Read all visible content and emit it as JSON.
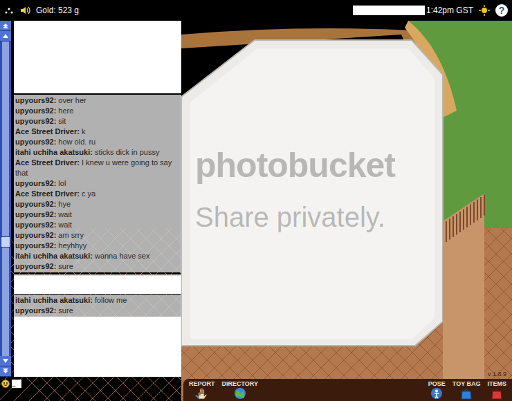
{
  "top_bar": {
    "gold": "Gold: 523 g",
    "time": "1:42pm GST",
    "help": "?"
  },
  "chat": {
    "messages_top": [
      {
        "user": "upyours92:",
        "text": "over her"
      },
      {
        "user": "upyours92:",
        "text": "here"
      },
      {
        "user": "upyours92:",
        "text": "sit"
      },
      {
        "user": "Ace Street Driver:",
        "text": "k"
      },
      {
        "user": "upyours92:",
        "text": "how old. ru"
      },
      {
        "user": "itahi uchiha akatsuki:",
        "text": "sticks dick in pussy"
      },
      {
        "user": "Ace Street Driver:",
        "text": "I knew u were going to say that"
      },
      {
        "user": "upyours92:",
        "text": "lol"
      },
      {
        "user": "Ace Street Driver:",
        "text": "c ya"
      },
      {
        "user": "upyours92:",
        "text": "hye"
      },
      {
        "user": "upyours92:",
        "text": "wait"
      },
      {
        "user": "upyours92:",
        "text": "wait"
      },
      {
        "user": "upyours92:",
        "text": "am srry"
      },
      {
        "user": "upyours92:",
        "text": "heyhhyy"
      },
      {
        "user": "itahi uchiha akatsuki:",
        "text": "wanna have sex"
      },
      {
        "user": "upyours92:",
        "text": "sure"
      }
    ],
    "messages_bottom": [
      {
        "user": "itahi uchiha akatsuki:",
        "text": "follow me"
      },
      {
        "user": "upyours92:",
        "text": "sure"
      }
    ],
    "input": "_"
  },
  "toolbar": [
    {
      "label": "REPORT"
    },
    {
      "label": "DIRECTORY"
    },
    {
      "label": "POSE"
    },
    {
      "label": "TOY BAG"
    },
    {
      "label": "ITEMS"
    }
  ],
  "version": "v 1.8.9",
  "watermark": {
    "brand": "photobucket",
    "tagline": "Share privately."
  }
}
